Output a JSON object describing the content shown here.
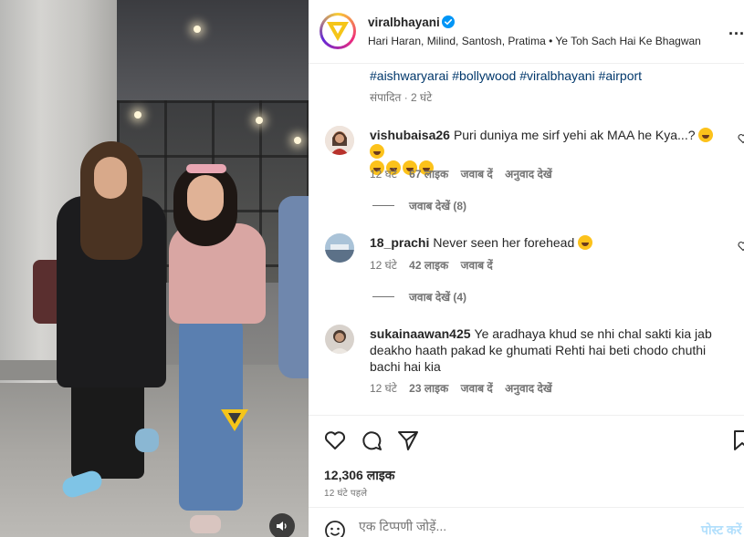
{
  "post": {
    "username": "viralbhayani",
    "verified": true,
    "audio_line": "Hari Haran, Milind, Santosh, Pratima • Ye Toh Sach Hai Ke Bhagwan",
    "more_label": "..."
  },
  "caption": {
    "hashtags": "#aishwaryarai #bollywood #viralbhayani #airport",
    "edited": "संपादित · 2 घंटे"
  },
  "media": {
    "watermark": "viral bhayani",
    "audio_icon": "speaker-icon"
  },
  "comments": [
    {
      "username": "vishubaisa26",
      "text": "Puri duniya me sirf yehi ak MAA he Kya...?",
      "emoji_count_line1": 2,
      "emoji_count_line2": 4,
      "time": "12 घंटे",
      "likes": "67 लाइक",
      "reply": "जवाब दें",
      "translate": "अनुवाद देखें",
      "view_replies": "जवाब देखें (8)"
    },
    {
      "username": "18_prachi",
      "text": "Never seen her forehead",
      "emoji_count_line1": 1,
      "time": "12 घंटे",
      "likes": "42 लाइक",
      "reply": "जवाब दें",
      "view_replies": "जवाब देखें (4)"
    },
    {
      "username": "sukainaawan425",
      "text": "Ye aradhaya khud se nhi chal sakti kia jab deakho haath pakad ke ghumati Rehti hai beti chodo chuthi bachi hai kia",
      "time": "12 घंटे",
      "likes": "23 लाइक",
      "reply": "जवाब दें",
      "translate": "अनुवाद देखें"
    }
  ],
  "actions": {
    "likes": "12,306 लाइक",
    "time": "12 घंटे पहले"
  },
  "add_comment": {
    "placeholder": "एक टिप्पणी जोड़ें...",
    "post_label": "पोस्ट करें"
  },
  "colors": {
    "link": "#00376b",
    "muted": "#737373",
    "verified": "#0095f6",
    "post_disabled": "#b2dffc"
  }
}
